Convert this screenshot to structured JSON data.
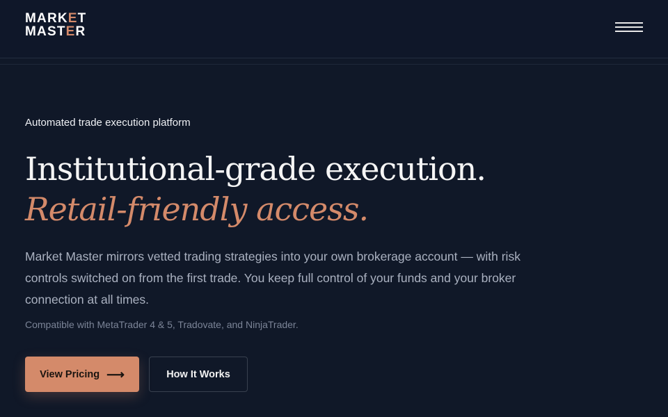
{
  "header": {
    "logo_line1_a": "MARK",
    "logo_line1_b": "E",
    "logo_line1_c": "T",
    "logo_line2_a": "MAST",
    "logo_line2_b": "E",
    "logo_line2_c": "R",
    "menu_icon": "hamburger-icon"
  },
  "hero": {
    "eyebrow": "Automated trade execution platform",
    "headline_plain": "Institutional-grade execution.",
    "headline_accent": "Retail-friendly access.",
    "lead": "Market Master mirrors vetted trading strategies into your own brokerage account — with risk controls switched on from the first trade. You keep full control of your funds and your broker connection at all times.",
    "compatibility": "Compatible with MetaTrader 4 & 5, Tradovate, and NinjaTrader."
  },
  "cta": {
    "primary_label": "View Pricing",
    "primary_icon": "arrow-right-icon",
    "secondary_label": "How It Works"
  },
  "colors": {
    "background": "#101828",
    "accent": "#d48a6a",
    "text": "#f2f2f2",
    "muted": "#aab1c0"
  }
}
